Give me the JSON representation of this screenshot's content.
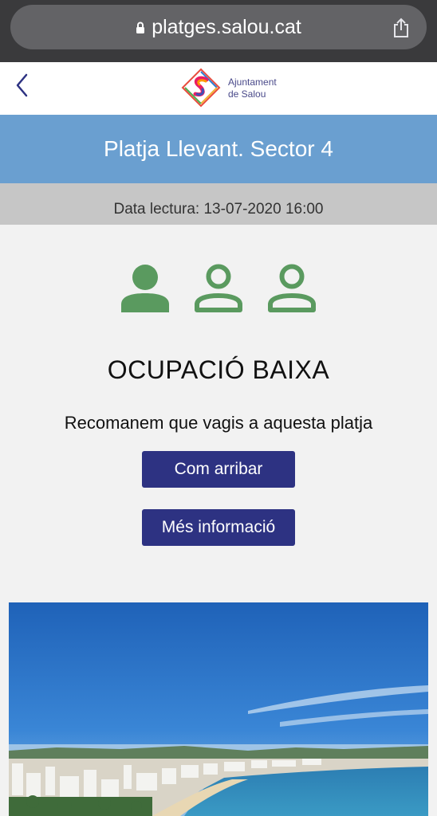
{
  "browser": {
    "url": "platges.salou.cat"
  },
  "header": {
    "logo_line1": "Ajuntament",
    "logo_line2": "de Salou"
  },
  "beach": {
    "title": "Platja Llevant. Sector 4",
    "reading_date": "Data lectura: 13-07-2020 16:00"
  },
  "occupancy": {
    "level_filled": 1,
    "level_total": 3,
    "status": "OCUPACIÓ BAIXA",
    "recommendation": "Recomanem que vagis a aquesta platja"
  },
  "actions": {
    "how_to_get_label": "Com arribar",
    "more_info_label": "Més informació"
  },
  "colors": {
    "accent_green": "#5a9a5f",
    "title_blue": "#6a9fd0",
    "button_navy": "#2d3282"
  }
}
